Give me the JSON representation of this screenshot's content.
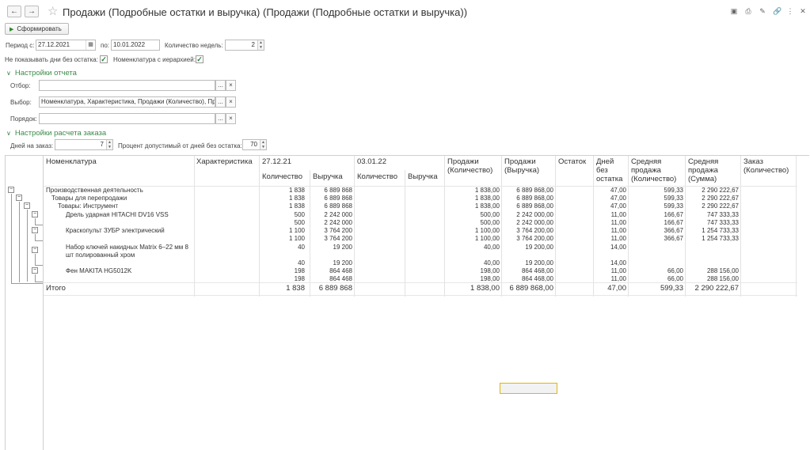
{
  "window": {
    "title": "Продажи (Подробные остатки и выручка) (Продажи (Подробные остатки и выручка))"
  },
  "toolbar": {
    "form_label": "Сформировать"
  },
  "params": {
    "period_label": "Период с:",
    "period_from": "27.12.2021",
    "to_label": "по:",
    "period_to": "10.01.2022",
    "weeks_label": "Количество недель:",
    "weeks_value": "2",
    "hide_days_label": "Не показывать дни без остатка:",
    "hierarchy_label": "Номенклатура с иерархией:"
  },
  "report_settings": {
    "title": "Настройки отчета",
    "filter_label": "Отбор:",
    "filter_value": "",
    "select_label": "Выбор:",
    "select_value": "Номенклатура, Характеристика, Продажи (Количество), Продажи (Выручка), Остаток...",
    "order_label": "Порядок:",
    "order_value": ""
  },
  "order_settings": {
    "title": "Настройки расчета заказа",
    "days_label": "Дней на заказ:",
    "days_value": "7",
    "percent_label": "Процент допустимый от дней без остатка:",
    "percent_value": "70"
  },
  "table": {
    "headers": {
      "nomenclature": "Номенклатура",
      "characteristic": "Характеристика",
      "date1": "27.12.21",
      "date2": "03.01.22",
      "qty": "Количество",
      "revenue": "Выручка",
      "sales_qty": "Продажи (Количество)",
      "sales_rev": "Продажи (Выручка)",
      "stock": "Остаток",
      "days_no_stock": "Дней без остатка",
      "avg_qty": "Средняя продажа (Количество)",
      "avg_sum": "Средняя продажа (Сумма)",
      "order_qty": "Заказ (Количество)"
    },
    "rows": [
      {
        "name": "Производственная деятельность",
        "q1": "1 838",
        "r1": "6 889 868",
        "sq": "1 838,00",
        "sr": "6 889 868,00",
        "days": "47,00",
        "aq": "599,33",
        "as": "2 290 222,67"
      },
      {
        "name": "Товары для перепродажи",
        "q1": "1 838",
        "r1": "6 889 868",
        "sq": "1 838,00",
        "sr": "6 889 868,00",
        "days": "47,00",
        "aq": "599,33",
        "as": "2 290 222,67"
      },
      {
        "name": "Товары: Инструмент",
        "q1": "1 838",
        "r1": "6 889 868",
        "sq": "1 838,00",
        "sr": "6 889 868,00",
        "days": "47,00",
        "aq": "599,33",
        "as": "2 290 222,67"
      },
      {
        "name": "Дрель ударная HITACHI DV16 VSS",
        "q1": "500",
        "r1": "2 242 000",
        "sq": "500,00",
        "sr": "2 242 000,00",
        "days": "11,00",
        "aq": "166,67",
        "as": "747 333,33"
      },
      {
        "name": "",
        "q1": "500",
        "r1": "2 242 000",
        "sq": "500,00",
        "sr": "2 242 000,00",
        "days": "11,00",
        "aq": "166,67",
        "as": "747 333,33"
      },
      {
        "name": "Краскопульт ЗУБР электрический",
        "q1": "1 100",
        "r1": "3 764 200",
        "sq": "1 100,00",
        "sr": "3 764 200,00",
        "days": "11,00",
        "aq": "366,67",
        "as": "1 254 733,33"
      },
      {
        "name": "",
        "q1": "1 100",
        "r1": "3 764 200",
        "sq": "1 100,00",
        "sr": "3 764 200,00",
        "days": "11,00",
        "aq": "366,67",
        "as": "1 254 733,33"
      },
      {
        "name": "Набор ключей накидных Matrix 6–22 мм 8 шт полированный хром",
        "q1": "40",
        "r1": "19 200",
        "sq": "40,00",
        "sr": "19 200,00",
        "days": "14,00",
        "aq": "",
        "as": ""
      },
      {
        "name": "",
        "q1": "40",
        "r1": "19 200",
        "sq": "40,00",
        "sr": "19 200,00",
        "days": "14,00",
        "aq": "",
        "as": ""
      },
      {
        "name": "Фен MAKITA HG5012K",
        "q1": "198",
        "r1": "864 468",
        "sq": "198,00",
        "sr": "864 468,00",
        "days": "11,00",
        "aq": "66,00",
        "as": "288 156,00"
      },
      {
        "name": "",
        "q1": "198",
        "r1": "864 468",
        "sq": "198,00",
        "sr": "864 468,00",
        "days": "11,00",
        "aq": "66,00",
        "as": "288 156,00"
      }
    ],
    "total": {
      "name": "Итого",
      "q1": "1 838",
      "r1": "6 889 868",
      "sq": "1 838,00",
      "sr": "6 889 868,00",
      "days": "47,00",
      "aq": "599,33",
      "as": "2 290 222,67"
    }
  }
}
